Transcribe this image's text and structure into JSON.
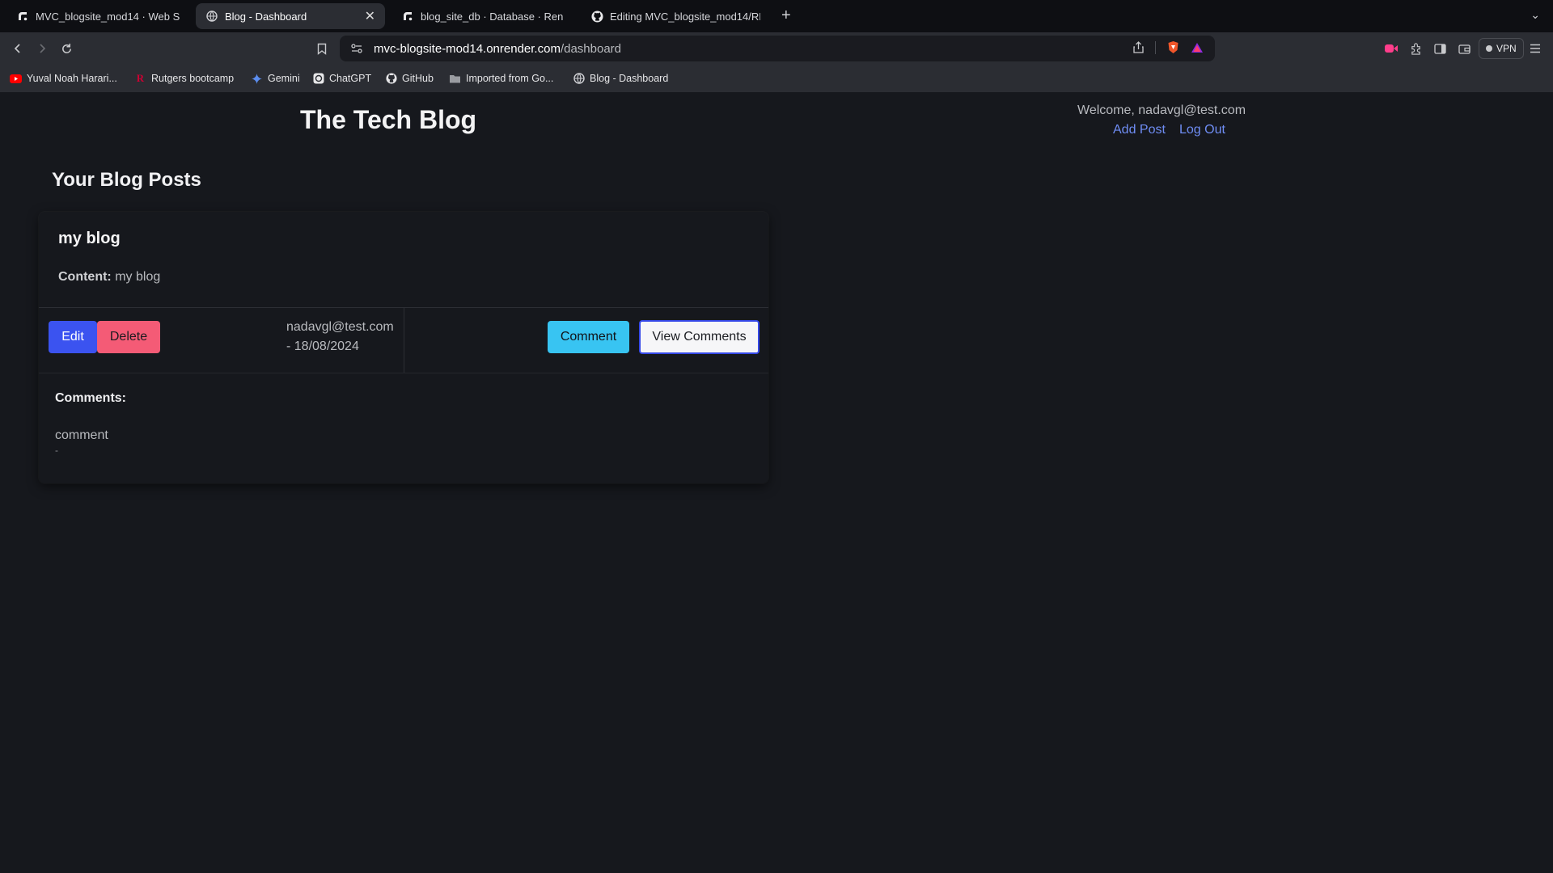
{
  "browser": {
    "tabs": [
      {
        "title": "MVC_blogsite_mod14 · Web Se",
        "icon": "render-icon",
        "active": false
      },
      {
        "title": "Blog - Dashboard",
        "icon": "globe-icon",
        "active": true
      },
      {
        "title": "blog_site_db · Database · Ren",
        "icon": "render-icon",
        "active": false
      },
      {
        "title": "Editing MVC_blogsite_mod14/RE",
        "icon": "github-icon",
        "active": false
      }
    ],
    "address": {
      "host": "mvc-blogsite-mod14.onrender.com",
      "path": "/dashboard"
    },
    "vpn_label": "VPN",
    "bookmarks": [
      {
        "label": "Yuval Noah Harari...",
        "icon": "youtube-icon"
      },
      {
        "label": "Rutgers bootcamp",
        "icon": "rutgers-icon"
      },
      {
        "label": "Gemini",
        "icon": "gemini-icon"
      },
      {
        "label": "ChatGPT",
        "icon": "chatgpt-icon"
      },
      {
        "label": "GitHub",
        "icon": "github-icon"
      },
      {
        "label": "Imported from Go...",
        "icon": "folder-icon"
      },
      {
        "label": "Blog - Dashboard",
        "icon": "globe-icon"
      }
    ]
  },
  "header": {
    "title": "The Tech Blog",
    "welcome": "Welcome, nadavgl@test.com",
    "add_post": "Add Post",
    "log_out": "Log Out"
  },
  "dashboard": {
    "section_title": "Your Blog Posts",
    "post": {
      "title": "my blog",
      "content_label": "Content:",
      "content": "my blog",
      "author": "nadavgl@test.com",
      "date_line": "- 18/08/2024",
      "edit_label": "Edit",
      "delete_label": "Delete",
      "comment_label": "Comment",
      "view_comments_label": "View Comments",
      "comments_title": "Comments:",
      "comments": [
        {
          "text": "comment",
          "meta": "-"
        }
      ]
    }
  },
  "colors": {
    "page_bg": "#16181d",
    "link": "#6f8df4",
    "edit_button": "#3b53f0",
    "delete_button": "#f45b76",
    "comment_button": "#38c4f2"
  }
}
